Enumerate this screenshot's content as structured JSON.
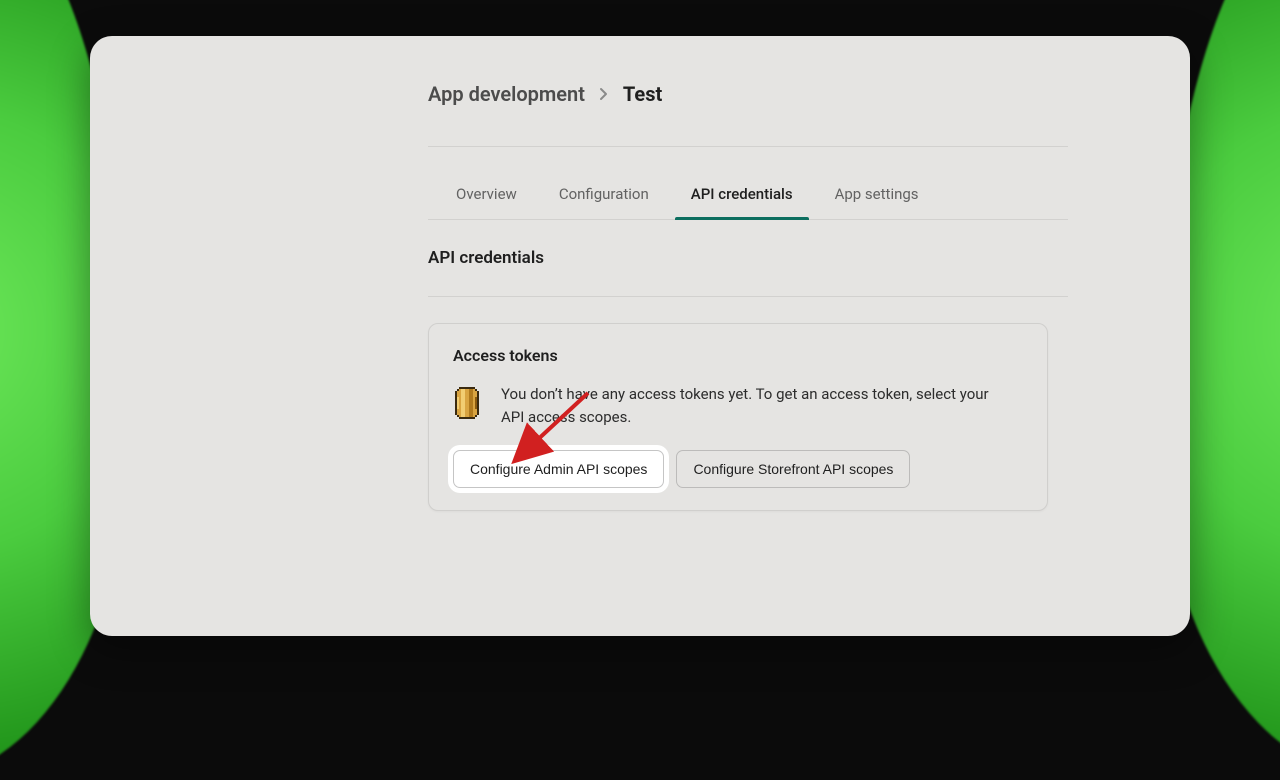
{
  "breadcrumb": {
    "root": "App development",
    "current": "Test"
  },
  "tabs": {
    "items": [
      {
        "label": "Overview",
        "active": false
      },
      {
        "label": "Configuration",
        "active": false
      },
      {
        "label": "API credentials",
        "active": true
      },
      {
        "label": "App settings",
        "active": false
      }
    ]
  },
  "section": {
    "title": "API credentials"
  },
  "card": {
    "title": "Access tokens",
    "body": "You don’t have any access tokens yet. To get an access token, select your API access scopes.",
    "actions": {
      "admin": "Configure Admin API scopes",
      "storefront": "Configure Storefront API scopes"
    }
  },
  "icons": {
    "breadcrumb_separator": "chevron-right-icon",
    "coin": "coin-icon"
  }
}
